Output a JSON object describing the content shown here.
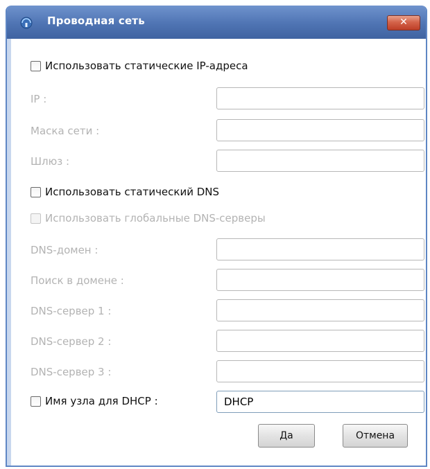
{
  "window": {
    "title": "Проводная сеть",
    "close_label": "✕",
    "title_icon": "wired-network-icon"
  },
  "static_ip": {
    "checkbox_label": "Использовать статические IP-адреса",
    "checked": false,
    "ip_label": "IP :",
    "ip_value": "",
    "netmask_label": "Маска сети :",
    "netmask_value": "",
    "gateway_label": "Шлюз :",
    "gateway_value": ""
  },
  "dns": {
    "static_dns_label": "Использовать статический DNS",
    "static_dns_checked": false,
    "global_dns_label": "Использовать глобальные DNS-серверы",
    "global_dns_checked": false,
    "domain_label": "DNS-домен :",
    "domain_value": "",
    "search_label": "Поиск в домене :",
    "search_value": "",
    "server1_label": "DNS-сервер 1 :",
    "server1_value": "",
    "server2_label": "DNS-сервер 2 :",
    "server2_value": "",
    "server3_label": "DNS-сервер 3 :",
    "server3_value": ""
  },
  "dhcp": {
    "hostname_label": "Имя узла для DHCP :",
    "hostname_checked": false,
    "hostname_value": "DHCP"
  },
  "buttons": {
    "ok_label": "Да",
    "cancel_label": "Отмена"
  },
  "colors": {
    "titlebar": "#4f74b3",
    "close_button": "#d4634a",
    "disabled_text": "#b3b3b3"
  }
}
